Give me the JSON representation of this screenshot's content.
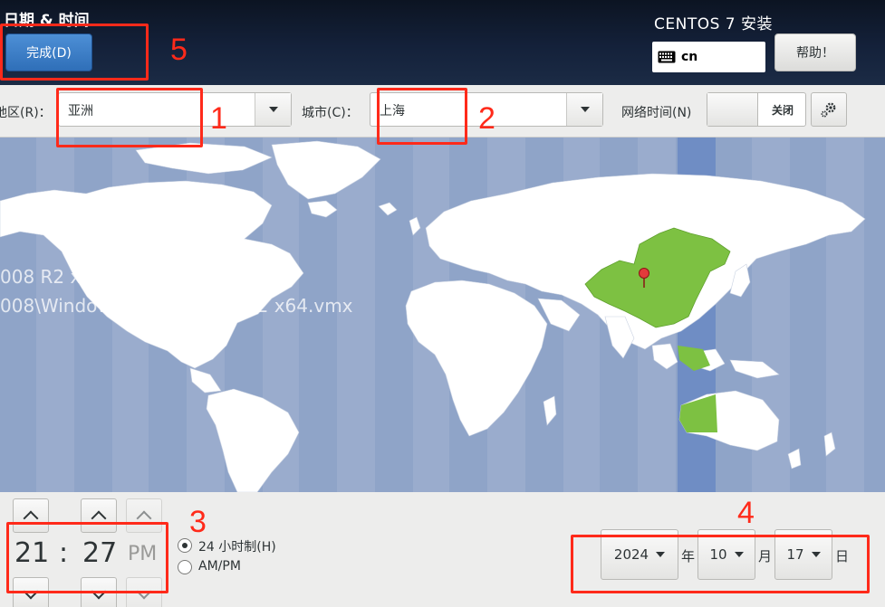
{
  "header": {
    "page_title": "日期 & 时间",
    "done_label": "完成(D)",
    "install_title": "CENTOS 7 安装",
    "keyboard_layout": "cn",
    "help_label": "帮助！"
  },
  "toolbar": {
    "region_label": "地区(R)：",
    "region_value": "亚洲",
    "city_label": "城市(C)：",
    "city_value": "上海",
    "ntp_label": "网络时间(N)",
    "ntp_state": "关闭"
  },
  "map": {
    "background_text_line1": "008 R2 x64",
    "background_text_line2": "008\\Windows Server 2008 R2 x64.vmx",
    "selected_region_color": "#7dc142",
    "ocean_color": "#8fa4c8",
    "timezone_highlight_color": "#6f8dc4"
  },
  "time": {
    "hours": "21",
    "separator": ":",
    "minutes": "27",
    "ampm": "PM",
    "format_24h_label": "24 小时制(H)",
    "format_ampm_label": "AM/PM",
    "selected_format": "24h"
  },
  "date": {
    "year": "2024",
    "year_unit": "年",
    "month": "10",
    "month_unit": "月",
    "day": "17",
    "day_unit": "日"
  },
  "annotations": {
    "labels": [
      "1",
      "2",
      "3",
      "4",
      "5"
    ],
    "color": "#ff2a1a"
  }
}
